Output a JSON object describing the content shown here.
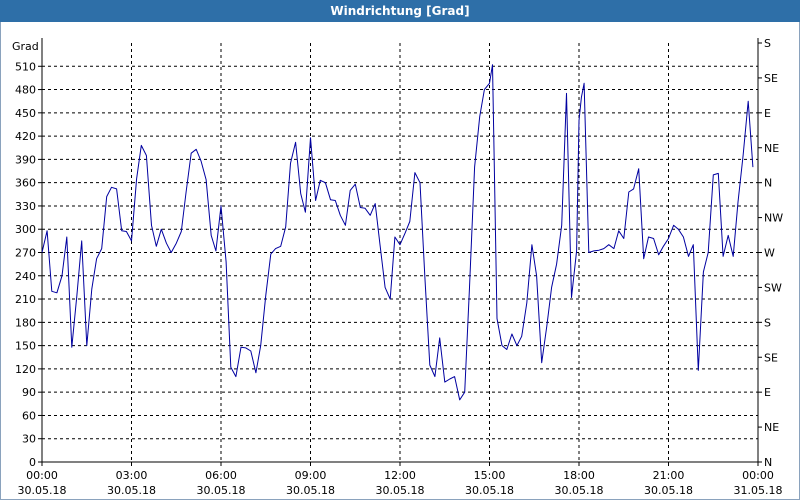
{
  "window": {
    "title": "Windrichtung [Grad]"
  },
  "chart_data": {
    "type": "line",
    "title": "Windrichtung [Grad]",
    "ylabel": "Grad",
    "xlabel": "",
    "ylim": [
      0,
      540
    ],
    "grid": true,
    "y_ticks": [
      0,
      30,
      60,
      90,
      120,
      150,
      180,
      210,
      240,
      270,
      300,
      330,
      360,
      390,
      420,
      450,
      480,
      510
    ],
    "right_ticks": [
      {
        "value": 0,
        "label": "N"
      },
      {
        "value": 45,
        "label": "NE"
      },
      {
        "value": 90,
        "label": "E"
      },
      {
        "value": 135,
        "label": "SE"
      },
      {
        "value": 180,
        "label": "S"
      },
      {
        "value": 225,
        "label": "SW"
      },
      {
        "value": 270,
        "label": "W"
      },
      {
        "value": 315,
        "label": "NW"
      },
      {
        "value": 360,
        "label": "N"
      },
      {
        "value": 405,
        "label": "NE"
      },
      {
        "value": 450,
        "label": "E"
      },
      {
        "value": 495,
        "label": "SE"
      },
      {
        "value": 540,
        "label": "S"
      }
    ],
    "x_range_hours": [
      0,
      24
    ],
    "x_ticks": [
      {
        "h": 0,
        "time": "00:00",
        "date": "30.05.18"
      },
      {
        "h": 3,
        "time": "03:00",
        "date": "30.05.18"
      },
      {
        "h": 6,
        "time": "06:00",
        "date": "30.05.18"
      },
      {
        "h": 9,
        "time": "09:00",
        "date": "30.05.18"
      },
      {
        "h": 12,
        "time": "12:00",
        "date": "30.05.18"
      },
      {
        "h": 15,
        "time": "15:00",
        "date": "30.05.18"
      },
      {
        "h": 18,
        "time": "18:00",
        "date": "30.05.18"
      },
      {
        "h": 21,
        "time": "21:00",
        "date": "30.05.18"
      },
      {
        "h": 24,
        "time": "00:00",
        "date": "31.05.18"
      }
    ],
    "series": [
      {
        "color": "#0000a0",
        "points": [
          [
            0.0,
            270
          ],
          [
            0.17,
            298
          ],
          [
            0.33,
            220
          ],
          [
            0.5,
            218
          ],
          [
            0.67,
            240
          ],
          [
            0.83,
            290
          ],
          [
            1.0,
            148
          ],
          [
            1.17,
            215
          ],
          [
            1.33,
            285
          ],
          [
            1.5,
            150
          ],
          [
            1.67,
            223
          ],
          [
            1.83,
            262
          ],
          [
            2.0,
            275
          ],
          [
            2.17,
            342
          ],
          [
            2.33,
            354
          ],
          [
            2.5,
            352
          ],
          [
            2.67,
            298
          ],
          [
            2.83,
            297
          ],
          [
            3.0,
            285
          ],
          [
            3.17,
            365
          ],
          [
            3.33,
            408
          ],
          [
            3.5,
            395
          ],
          [
            3.67,
            305
          ],
          [
            3.83,
            278
          ],
          [
            4.0,
            300
          ],
          [
            4.17,
            282
          ],
          [
            4.33,
            270
          ],
          [
            4.5,
            282
          ],
          [
            4.67,
            297
          ],
          [
            4.83,
            348
          ],
          [
            5.0,
            398
          ],
          [
            5.17,
            403
          ],
          [
            5.33,
            388
          ],
          [
            5.5,
            364
          ],
          [
            5.67,
            292
          ],
          [
            5.83,
            272
          ],
          [
            6.0,
            330
          ],
          [
            6.17,
            258
          ],
          [
            6.33,
            122
          ],
          [
            6.5,
            110
          ],
          [
            6.67,
            148
          ],
          [
            6.83,
            147
          ],
          [
            7.0,
            143
          ],
          [
            7.17,
            115
          ],
          [
            7.33,
            150
          ],
          [
            7.5,
            215
          ],
          [
            7.67,
            268
          ],
          [
            7.83,
            275
          ],
          [
            8.0,
            278
          ],
          [
            8.17,
            303
          ],
          [
            8.33,
            385
          ],
          [
            8.5,
            412
          ],
          [
            8.67,
            346
          ],
          [
            8.83,
            322
          ],
          [
            9.0,
            418
          ],
          [
            9.17,
            337
          ],
          [
            9.33,
            363
          ],
          [
            9.5,
            360
          ],
          [
            9.67,
            338
          ],
          [
            9.83,
            337
          ],
          [
            10.0,
            318
          ],
          [
            10.17,
            305
          ],
          [
            10.33,
            350
          ],
          [
            10.5,
            358
          ],
          [
            10.67,
            328
          ],
          [
            10.83,
            327
          ],
          [
            11.0,
            318
          ],
          [
            11.17,
            333
          ],
          [
            11.33,
            280
          ],
          [
            11.5,
            225
          ],
          [
            11.67,
            210
          ],
          [
            11.83,
            290
          ],
          [
            12.0,
            280
          ],
          [
            12.17,
            295
          ],
          [
            12.33,
            310
          ],
          [
            12.5,
            373
          ],
          [
            12.67,
            360
          ],
          [
            12.83,
            240
          ],
          [
            13.0,
            125
          ],
          [
            13.17,
            110
          ],
          [
            13.33,
            160
          ],
          [
            13.5,
            103
          ],
          [
            13.67,
            107
          ],
          [
            13.83,
            110
          ],
          [
            14.0,
            80
          ],
          [
            14.17,
            90
          ],
          [
            14.33,
            225
          ],
          [
            14.5,
            380
          ],
          [
            14.67,
            445
          ],
          [
            14.83,
            480
          ],
          [
            15.0,
            488
          ],
          [
            15.1,
            512
          ],
          [
            15.25,
            185
          ],
          [
            15.42,
            150
          ],
          [
            15.58,
            145
          ],
          [
            15.75,
            165
          ],
          [
            15.92,
            150
          ],
          [
            16.08,
            162
          ],
          [
            16.25,
            205
          ],
          [
            16.42,
            280
          ],
          [
            16.58,
            240
          ],
          [
            16.75,
            128
          ],
          [
            16.92,
            175
          ],
          [
            17.08,
            225
          ],
          [
            17.25,
            255
          ],
          [
            17.42,
            305
          ],
          [
            17.58,
            475
          ],
          [
            17.75,
            212
          ],
          [
            17.92,
            272
          ],
          [
            18.0,
            440
          ],
          [
            18.08,
            470
          ],
          [
            18.17,
            488
          ],
          [
            18.33,
            270
          ],
          [
            18.5,
            272
          ],
          [
            18.67,
            273
          ],
          [
            18.83,
            275
          ],
          [
            19.0,
            280
          ],
          [
            19.17,
            275
          ],
          [
            19.33,
            298
          ],
          [
            19.5,
            288
          ],
          [
            19.67,
            348
          ],
          [
            19.83,
            352
          ],
          [
            20.0,
            378
          ],
          [
            20.17,
            262
          ],
          [
            20.33,
            290
          ],
          [
            20.5,
            288
          ],
          [
            20.67,
            267
          ],
          [
            20.83,
            278
          ],
          [
            21.0,
            288
          ],
          [
            21.17,
            305
          ],
          [
            21.33,
            300
          ],
          [
            21.5,
            290
          ],
          [
            21.67,
            265
          ],
          [
            21.83,
            280
          ],
          [
            22.0,
            118
          ],
          [
            22.17,
            245
          ],
          [
            22.33,
            270
          ],
          [
            22.5,
            370
          ],
          [
            22.67,
            372
          ],
          [
            22.83,
            265
          ],
          [
            23.0,
            292
          ],
          [
            23.17,
            265
          ],
          [
            23.33,
            335
          ],
          [
            23.5,
            395
          ],
          [
            23.67,
            465
          ],
          [
            23.83,
            380
          ]
        ]
      }
    ]
  }
}
